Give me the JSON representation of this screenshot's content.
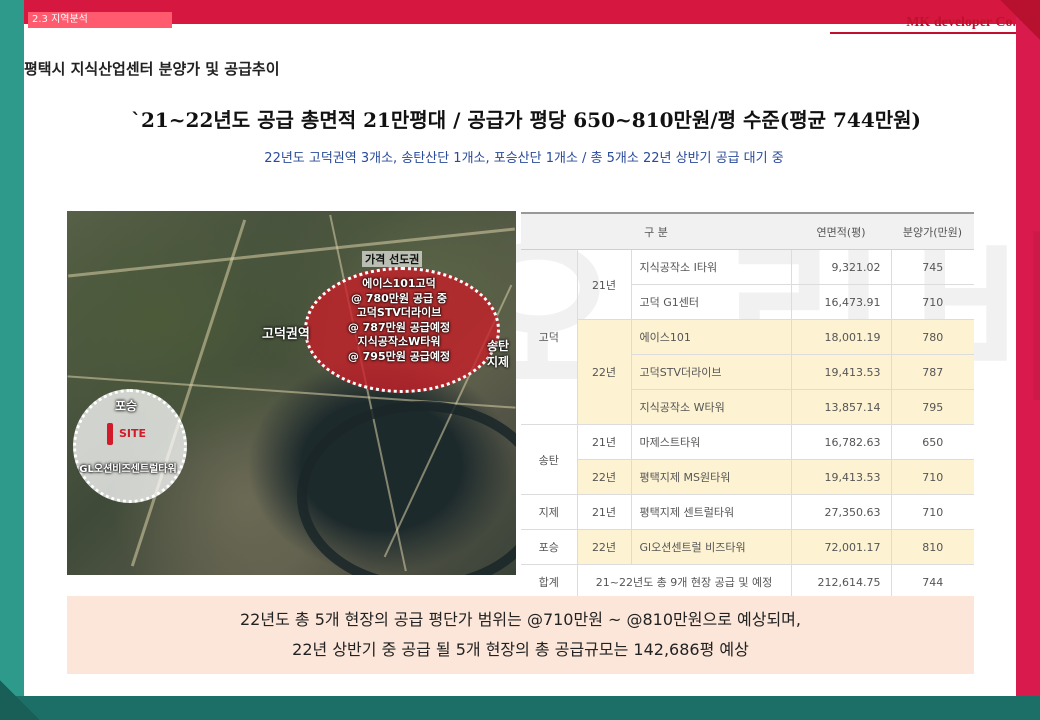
{
  "header": {
    "tag": "2.3 지역분석",
    "brand": "MK developer Co.",
    "page_title": "평택시 지식산업센터 분양가 및 공급추이"
  },
  "headline": "`21~22년도 공급 총면적 21만평대 / 공급가 평당 650~810만원/평 수준(평균 744만원)",
  "subheadline": "22년도 고덕권역 3개소, 송탄산단 1개소, 포승산단 1개소 / 총 5개소 22년 상반기 공급 대기 중",
  "watermark": "오시오 리비즈",
  "map": {
    "price_leader": "가격 선도권",
    "godeok_projects": [
      "에이스101고덕",
      "@ 780만원 공급 중",
      "고덕STV더라이브",
      "@ 787만원 공급예정",
      "지식공작소W타워",
      "@ 795만원 공급예정"
    ],
    "godeok_area": "고덕권역",
    "songtan": "송탄",
    "jije": "지제",
    "poseung": "포승",
    "site": "SITE",
    "site_name": "GL오션비즈센트럴타워"
  },
  "table": {
    "headers": [
      "구 분",
      "연면적(평)",
      "분양가(만원)"
    ],
    "rows": [
      {
        "region": "고덕",
        "year": "21년",
        "name": "지식공작소 I타워",
        "area": "9,321.02",
        "price": "745",
        "highlight": false
      },
      {
        "region": "",
        "year": "",
        "name": "고덕 G1센터",
        "area": "16,473.91",
        "price": "710",
        "highlight": false
      },
      {
        "region": "",
        "year": "22년",
        "name": "에이스101",
        "area": "18,001.19",
        "price": "780",
        "highlight": true
      },
      {
        "region": "",
        "year": "",
        "name": "고덕STV더라이브",
        "area": "19,413.53",
        "price": "787",
        "highlight": true
      },
      {
        "region": "",
        "year": "",
        "name": "지식공작소 W타워",
        "area": "13,857.14",
        "price": "795",
        "highlight": true
      },
      {
        "region": "송탄",
        "year": "21년",
        "name": "마제스트타워",
        "area": "16,782.63",
        "price": "650",
        "highlight": false
      },
      {
        "region": "",
        "year": "22년",
        "name": "평택지제 MS원타워",
        "area": "19,413.53",
        "price": "710",
        "highlight": true
      },
      {
        "region": "지제",
        "year": "21년",
        "name": "평택지제 센트럴타워",
        "area": "27,350.63",
        "price": "710",
        "highlight": false
      },
      {
        "region": "포승",
        "year": "22년",
        "name": "Gl오션센트럴 비즈타워",
        "area": "72,001.17",
        "price": "810",
        "highlight": true
      }
    ],
    "total": {
      "label": "합계",
      "desc": "21~22년도 총 9개 현장 공급 및 예정",
      "area": "212,614.75",
      "price": "744"
    }
  },
  "summary": {
    "line1": "22년도 총 5개 현장의 공급 평단가 범위는 @710만원 ~ @810만원으로 예상되며,",
    "line2": "22년 상반기 중 공급 될 5개 현장의 총 공급규모는 142,686평 예상"
  }
}
